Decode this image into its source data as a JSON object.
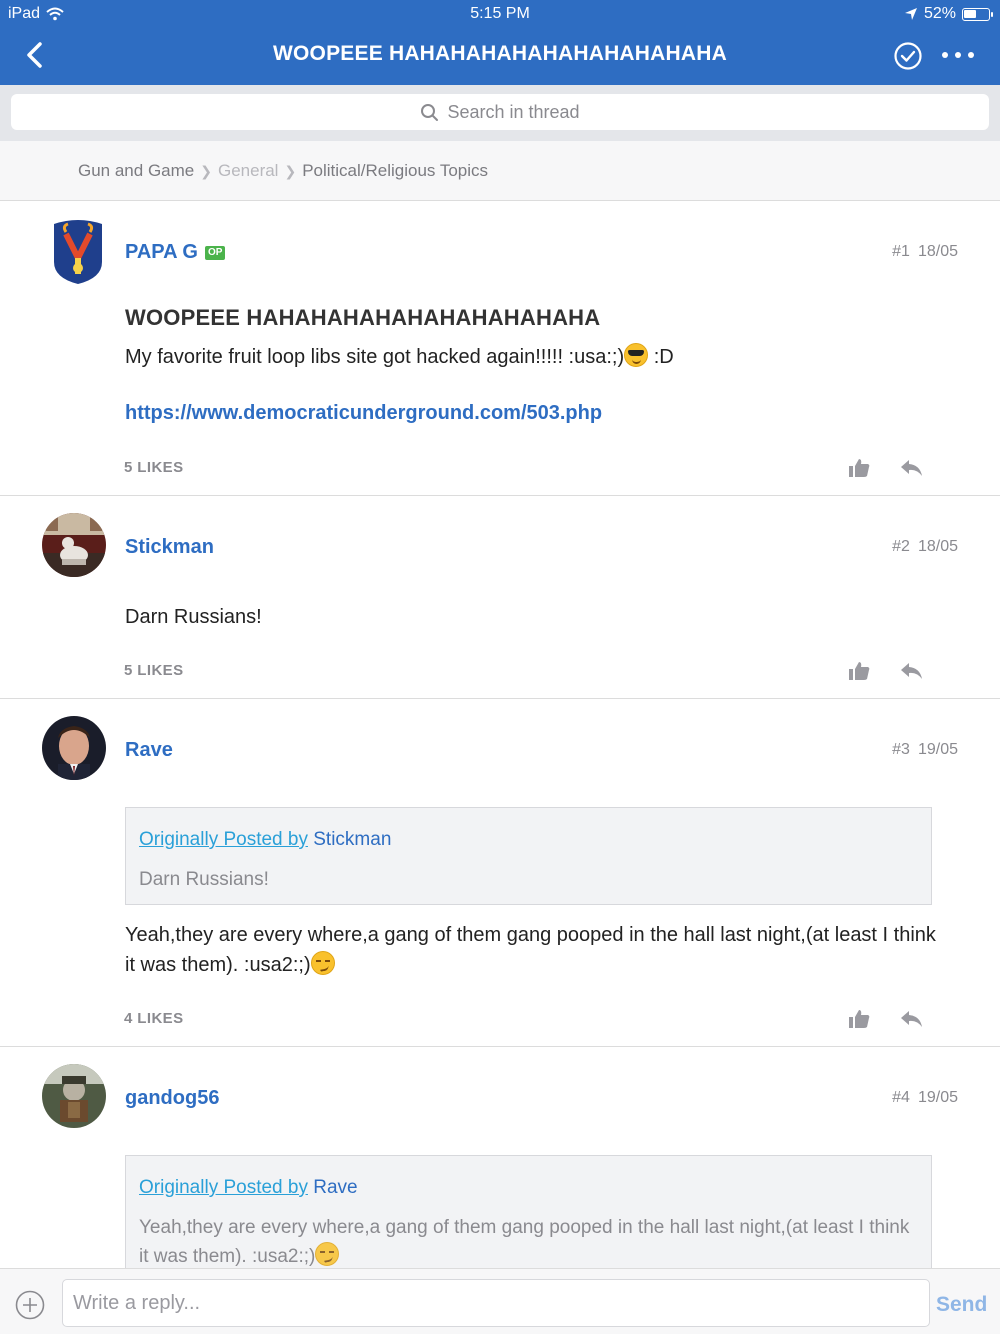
{
  "status_bar": {
    "device": "iPad",
    "time": "5:15 PM",
    "battery": "52%",
    "battery_level": 0.52
  },
  "header": {
    "title": "WOOPEEE HAHAHAHAHAHAHAHAHAHAHA"
  },
  "search": {
    "placeholder": "Search in thread"
  },
  "breadcrumb": {
    "items": [
      "Gun and Game",
      "General",
      "Political/Religious Topics"
    ]
  },
  "posts": [
    {
      "author": "PAPA G",
      "op_badge": "OP",
      "number": "#1",
      "date": "18/05",
      "title": "WOOPEEE HAHAHAHAHAHAHAHAHAHAHA",
      "body_before_emoji": "My favorite fruit loop libs site got hacked again!!!!! :usa:;)",
      "body_after_emoji": " :D",
      "link": "https://www.democraticunderground.com/503.php",
      "likes": "5 LIKES"
    },
    {
      "author": "Stickman",
      "number": "#2",
      "date": "18/05",
      "body": "Darn Russians!",
      "likes": "5 LIKES"
    },
    {
      "author": "Rave",
      "number": "#3",
      "date": "19/05",
      "quote": {
        "prefix": "Originally Posted by",
        "author": "Stickman",
        "text": "Darn Russians!"
      },
      "body": "Yeah,they are every where,a gang of them gang pooped in the hall last night,(at least I think it was them).  :usa2:;)",
      "likes": "4 LIKES"
    },
    {
      "author": "gandog56",
      "number": "#4",
      "date": "19/05",
      "quote": {
        "prefix": "Originally Posted by",
        "author": "Rave",
        "text": "Yeah,they are every where,a gang of them gang pooped in the hall last night,(at least I think it was them).  :usa2:;)"
      }
    }
  ],
  "reply_bar": {
    "placeholder": "Write a reply...",
    "send_label": "Send"
  },
  "colors": {
    "brand": "#2e6dc2",
    "quote_link": "#2aa0d8",
    "op_badge": "#4bb34b"
  },
  "icons": [
    "wifi-icon",
    "location-arrow-icon",
    "battery-icon",
    "back-chevron-icon",
    "check-circle-icon",
    "more-dots-icon",
    "search-icon",
    "thumbs-up-icon",
    "reply-arrow-icon",
    "plus-circle-icon"
  ]
}
